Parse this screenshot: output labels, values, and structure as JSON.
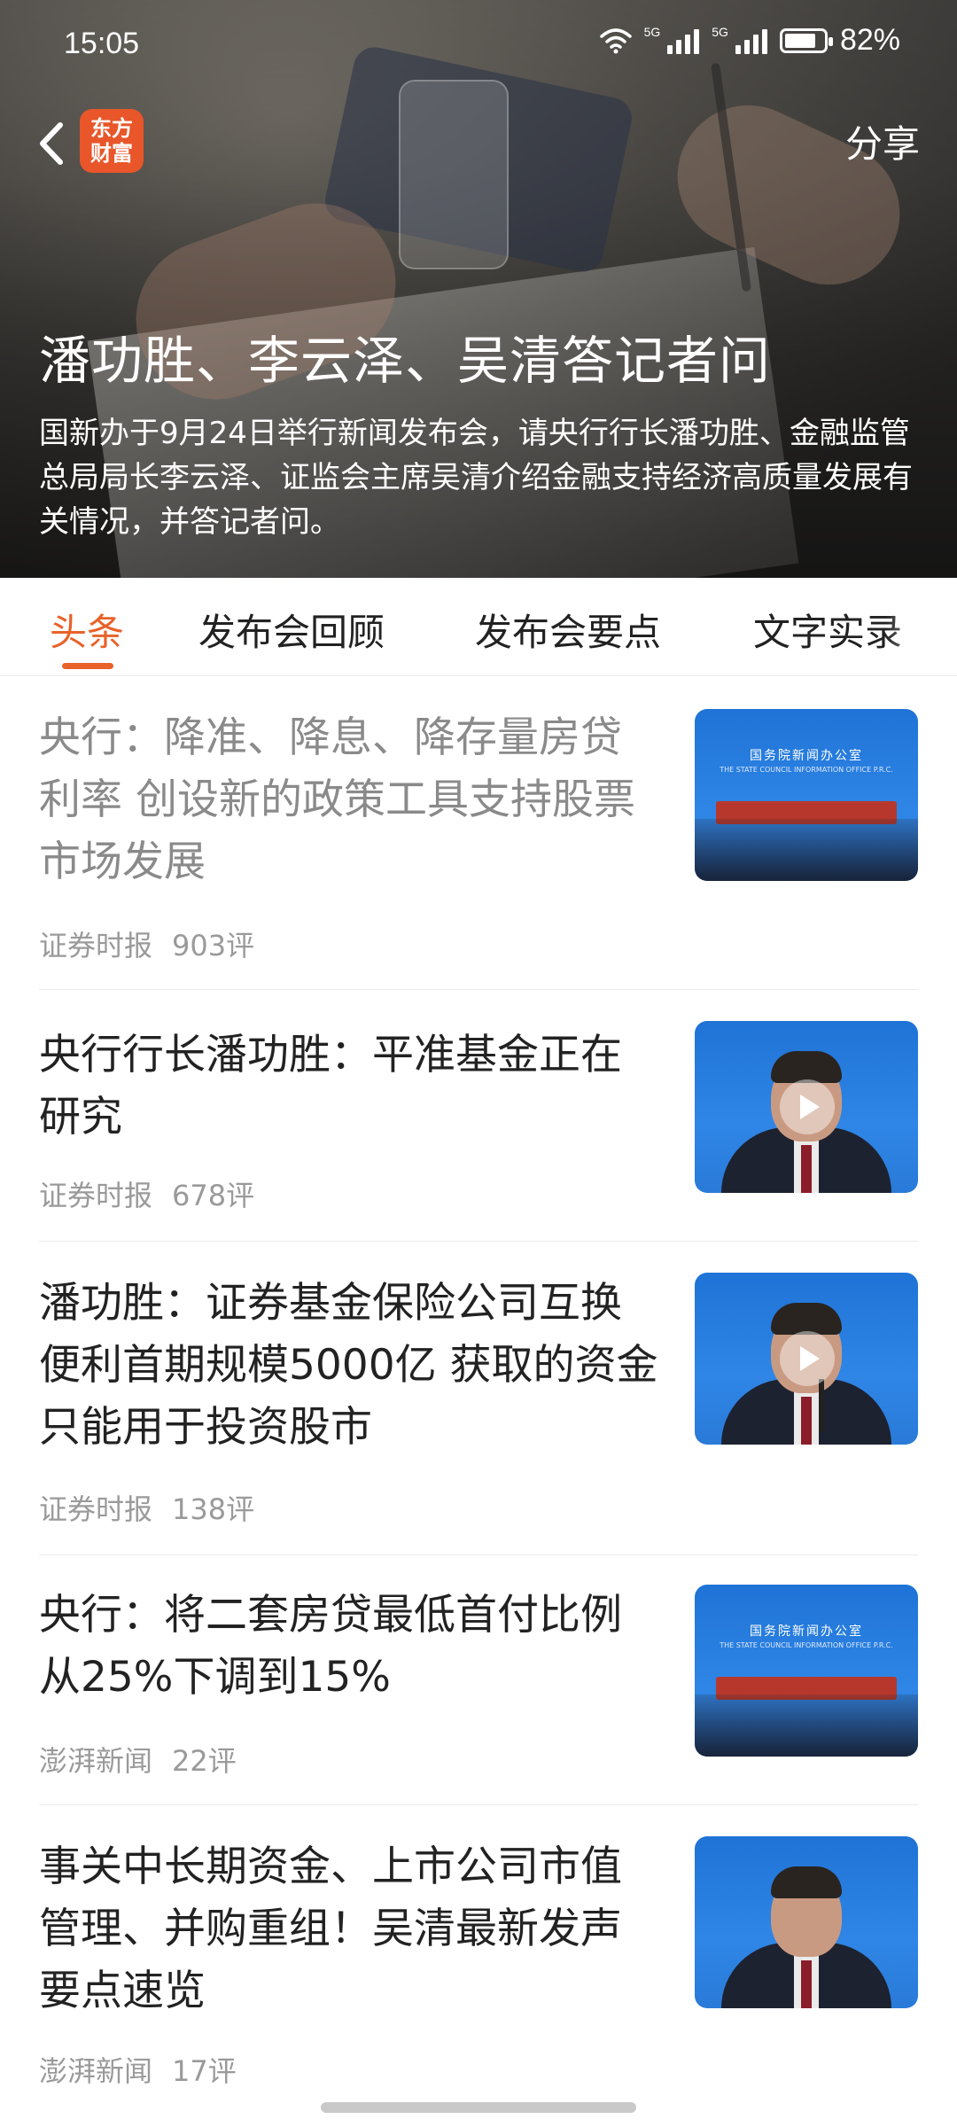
{
  "status_bar": {
    "time": "15:05",
    "net1": "5G",
    "net2": "5G",
    "battery_percent": "82%",
    "battery_level": 0.82
  },
  "header": {
    "logo_text_line1": "东方",
    "logo_text_line2": "财富",
    "share_label": "分享"
  },
  "hero": {
    "title": "潘功胜、李云泽、吴清答记者问",
    "description": "国新办于9月24日举行新闻发布会，请央行行长潘功胜、金融监管总局局长李云泽、证监会主席吴清介绍金融支持经济高质量发展有关情况，并答记者问。"
  },
  "tabs": [
    {
      "label": "头条",
      "active": true
    },
    {
      "label": "发布会回顾",
      "active": false
    },
    {
      "label": "发布会要点",
      "active": false
    },
    {
      "label": "文字实录",
      "active": false
    }
  ],
  "articles": [
    {
      "title": "央行：降准、降息、降存量房贷利率 创设新的政策工具支持股票市场发展",
      "source": "证券时报",
      "comments": "903评",
      "read": true,
      "video": false,
      "thumb": "press-conference"
    },
    {
      "title": "央行行长潘功胜：平准基金正在研究",
      "source": "证券时报",
      "comments": "678评",
      "read": false,
      "video": true,
      "thumb": "speaker-portrait"
    },
    {
      "title": "潘功胜：证券基金保险公司互换便利首期规模5000亿 获取的资金只能用于投资股市",
      "source": "证券时报",
      "comments": "138评",
      "read": false,
      "video": true,
      "thumb": "speaker-portrait"
    },
    {
      "title": "央行：将二套房贷最低首付比例从25%下调到15%",
      "source": "澎湃新闻",
      "comments": "22评",
      "read": false,
      "video": false,
      "thumb": "press-conference"
    },
    {
      "title": "事关中长期资金、上市公司市值管理、并购重组！吴清最新发声要点速览",
      "source": "澎湃新闻",
      "comments": "17评",
      "read": false,
      "video": false,
      "thumb": "speaker-portrait"
    }
  ],
  "thumb_banner": {
    "cn": "国务院新闻办公室",
    "en": "THE STATE COUNCIL INFORMATION OFFICE P.R.C."
  },
  "colors": {
    "accent": "#e8622a",
    "logo_bg": "#e8562a",
    "thumb_blue": "#2f86e6"
  }
}
